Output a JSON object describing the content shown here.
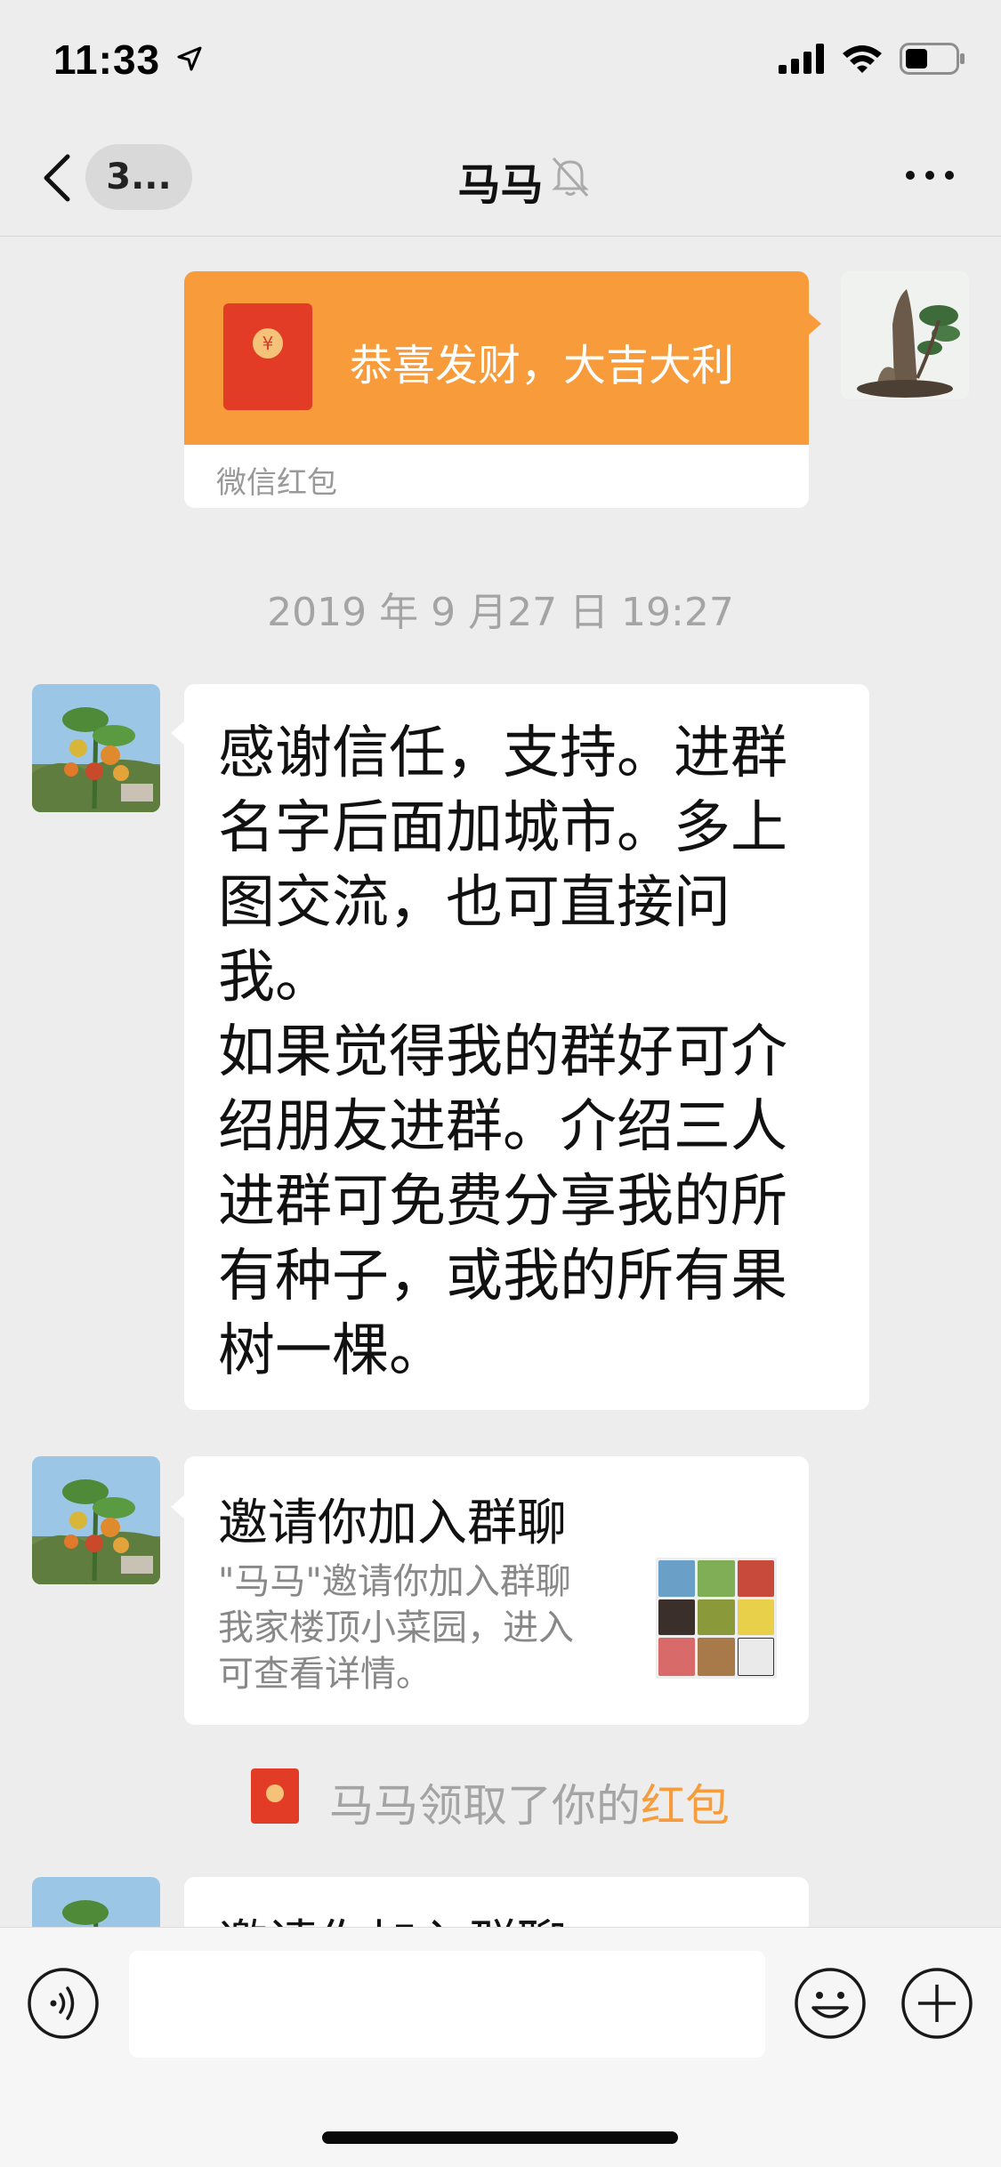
{
  "status_bar": {
    "time": "11:33"
  },
  "header": {
    "back_badge": "3...",
    "title": "马马"
  },
  "messages": {
    "red_packet": {
      "greeting": "恭喜发财，大吉大利",
      "label": "微信红包"
    },
    "timestamp": "2019 年 9 月27 日 19:27",
    "text_message": "感谢信任，支持。进群\n名字后面加城市。多上\n图交流，也可直接问\n我。\n如果觉得我的群好可介\n绍朋友进群。介绍三人\n进群可免费分享我的所\n有种子，或我的所有果\n树一棵。",
    "invite_1": {
      "title": "邀请你加入群聊",
      "description": "\"马马\"邀请你加入群聊\n我家楼顶小菜园，进入\n可查看详情。"
    },
    "system_notice": {
      "prefix": "马马领取了你的",
      "highlight": "红包"
    },
    "invite_2": {
      "title": "邀请你加入群聊"
    }
  },
  "input_bar": {
    "value": ""
  },
  "colors": {
    "background": "#ededed",
    "red_packet_orange": "#f79b3b",
    "red_packet_red": "#e23c27",
    "bubble": "#ffffff",
    "muted_text": "#a4a4a4"
  }
}
